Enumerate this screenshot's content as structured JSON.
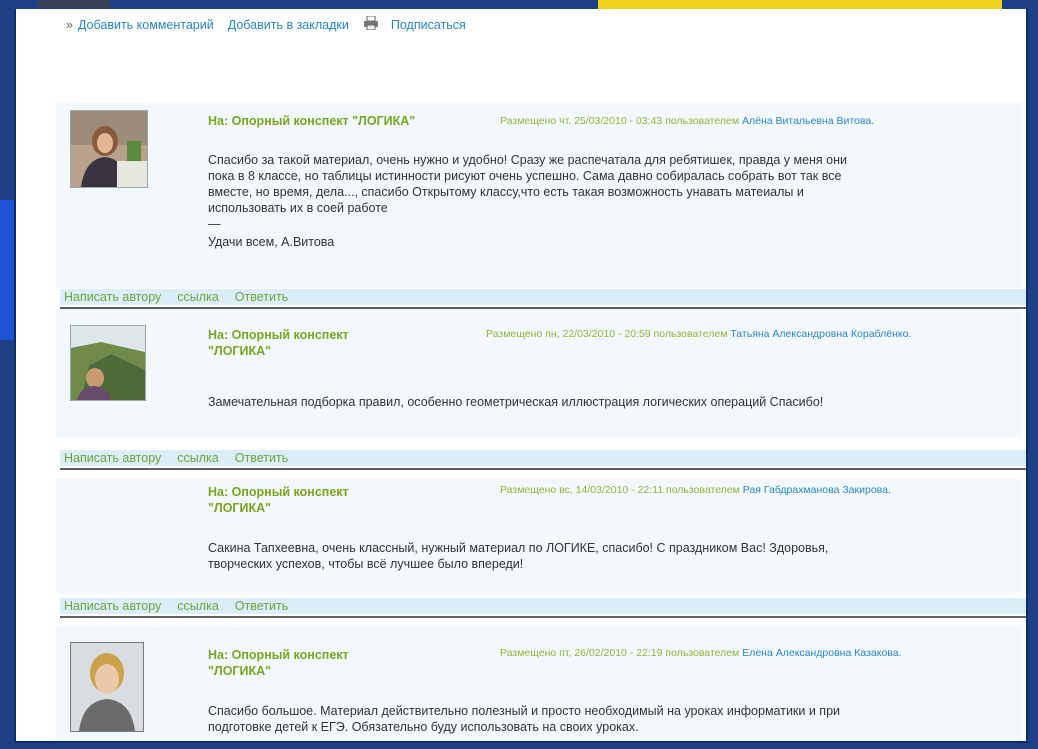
{
  "top_links": {
    "arrow": "»",
    "add_comment": "Добавить комментарий",
    "add_bookmark": "Добавить в закладки",
    "subscribe": "Подписаться"
  },
  "comments": [
    {
      "title": "На: Опорный конспект \"ЛОГИКА\"",
      "posted_prefix": "Размещено чт, 25/03/2010 - 03:43 пользователем",
      "author": "Алёна Витальевна Витова.",
      "lines": [
        "Спасибо за такой материал, очень нужно и удобно! Сразу же распечатала для ребятишек, правда у меня они",
        "пока в 8 классе, но таблицы истинности рисуют очень успешно. Сама давно собиралась собрать вот так все",
        "вместе, но время, дела..., спасибо Открытому классу,что есть такая возможность унавать матеиалы и",
        "использовать их в соей работе"
      ],
      "dash": "—",
      "signature": "Удачи всем, А.Витова",
      "actions": [
        "Написать автору",
        "ссылка",
        "Ответить"
      ]
    },
    {
      "title": "На: Опорный конспект \"ЛОГИКА\"",
      "posted_prefix": "Размещено пн, 22/03/2010 - 20:59 пользователем",
      "author": "Татьяна Александровна Кораблёнко.",
      "lines": [
        "Замечательная подборка правил, особенно геометрическая иллюстрация логических операций Спасибо!"
      ],
      "actions": [
        "Написать автору",
        "ссылка",
        "Ответить"
      ]
    },
    {
      "title": "На: Опорный конспект \"ЛОГИКА\"",
      "posted_prefix": "Размещено вс, 14/03/2010 - 22:11 пользователем",
      "author": "Рая Габдрахманова Закирова.",
      "lines": [
        "Сакина Тапхеевна, очень классный, нужный материал по ЛОГИКЕ, спасибо! С праздником Вас! Здоровья,",
        "творческих успехов, чтобы всё лучшее было впереди!"
      ],
      "actions": [
        "Написать автору",
        "ссылка",
        "Ответить"
      ]
    },
    {
      "title": "На: Опорный конспект \"ЛОГИКА\"",
      "posted_prefix": "Размещено пт, 26/02/2010 - 22:19 пользователем",
      "author": "Елена Александровна Казакова.",
      "lines": [
        "Спасибо большое. Материал действительно полезный и просто необходимый на уроках информатики и при",
        "подготовке детей к ЕГЭ. Обязательно буду использовать на своих уроках."
      ]
    }
  ]
}
